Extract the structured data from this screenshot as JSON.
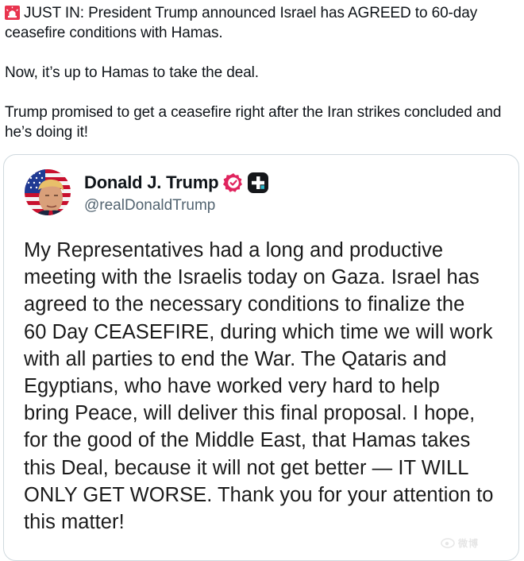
{
  "post": {
    "icon": "rotating-light-siren-emoji",
    "line1": "JUST IN: President Trump announced Israel has AGREED to 60-day",
    "line2": "ceasefire conditions with Hamas.",
    "para2": "Now, it’s up to Hamas to take the deal.",
    "para3_line1": "Trump promised to get a ceasefire right after the Iran strikes concluded and",
    "para3_line2": "he’s doing it!"
  },
  "embedded": {
    "display_name": "Donald J. Trump",
    "handle": "@realDonaldTrump",
    "verified_color": "#e0245e",
    "lines": [
      "My Representatives had a long and productive",
      "meeting with the Israelis today on Gaza. Israel has",
      "agreed to the necessary conditions to finalize the",
      "60 Day CEASEFIRE, during which time we will work",
      "with all parties to end the War. The Qataris and",
      "Egyptians, who have worked very hard to help",
      "bring Peace, will deliver this final proposal. I hope,",
      "for the good of the Middle East, that Hamas takes",
      "this Deal, because it will not get better — IT WILL",
      "ONLY GET WORSE. Thank you for your attention to",
      "this matter!"
    ]
  },
  "watermark": {
    "text": "微博"
  }
}
